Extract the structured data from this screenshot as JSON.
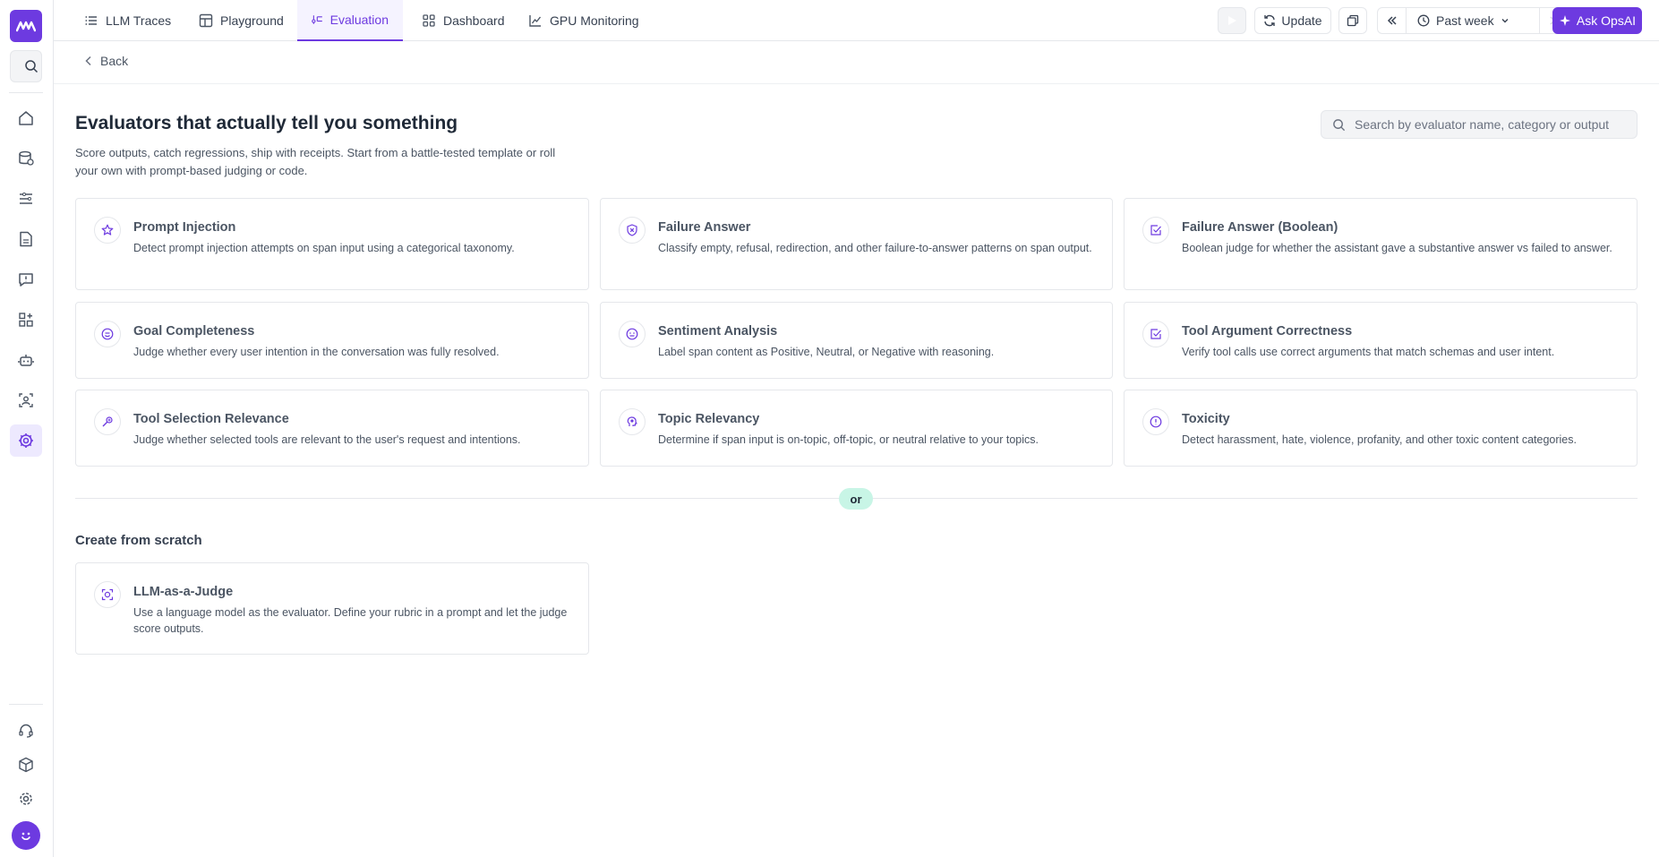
{
  "colors": {
    "accent": "#6d3ae0",
    "or_badge": "#c8f5e6",
    "border": "#e5e7eb"
  },
  "tabs": [
    {
      "label": "LLM Traces",
      "icon": "list-icon"
    },
    {
      "label": "Playground",
      "icon": "layout-icon"
    },
    {
      "label": "Evaluation",
      "icon": "evaluation-icon",
      "active": true
    },
    {
      "label": "Dashboard",
      "icon": "grid-icon"
    },
    {
      "label": "GPU Monitoring",
      "icon": "line-chart-icon"
    }
  ],
  "toolbar": {
    "update_label": "Update",
    "time_range": "Past week",
    "ask_label": "Ask OpsAI"
  },
  "back_label": "Back",
  "header": {
    "title": "Evaluators that actually tell you something",
    "subtitle": "Score outputs, catch regressions, ship with receipts. Start from a battle-tested template or roll your own with prompt-based judging or code."
  },
  "search": {
    "placeholder": "Search by evaluator name, category or output"
  },
  "templates": [
    {
      "title": "Prompt Injection",
      "desc": "Detect prompt injection attempts on span input using a categorical taxonomy.",
      "icon": "star-icon"
    },
    {
      "title": "Failure Answer",
      "desc": "Classify empty, refusal, redirection, and other failure-to-answer patterns on span output.",
      "icon": "shield-x-icon"
    },
    {
      "title": "Failure Answer (Boolean)",
      "desc": "Boolean judge for whether the assistant gave a substantive answer vs failed to answer.",
      "icon": "check-square-icon"
    },
    {
      "title": "Goal Completeness",
      "desc": "Judge whether every user intention in the conversation was fully resolved.",
      "icon": "smile-icon"
    },
    {
      "title": "Sentiment Analysis",
      "desc": "Label span content as Positive, Neutral, or Negative with reasoning.",
      "icon": "face-icon"
    },
    {
      "title": "Tool Argument Correctness",
      "desc": "Verify tool calls use correct arguments that match schemas and user intent.",
      "icon": "check-square-icon"
    },
    {
      "title": "Tool Selection Relevance",
      "desc": "Judge whether selected tools are relevant to the user's request and intentions.",
      "icon": "tool-icon"
    },
    {
      "title": "Topic Relevancy",
      "desc": "Determine if span input is on-topic, off-topic, or neutral relative to your topics.",
      "icon": "brain-icon"
    },
    {
      "title": "Toxicity",
      "desc": "Detect harassment, hate, violence, profanity, and other toxic content categories.",
      "icon": "alert-circle-icon"
    }
  ],
  "or_label": "or",
  "scratch": {
    "heading": "Create from scratch",
    "card": {
      "title": "LLM-as-a-Judge",
      "desc": "Use a language model as the evaluator. Define your rubric in a prompt and let the judge score outputs.",
      "icon": "scan-face-icon"
    }
  }
}
